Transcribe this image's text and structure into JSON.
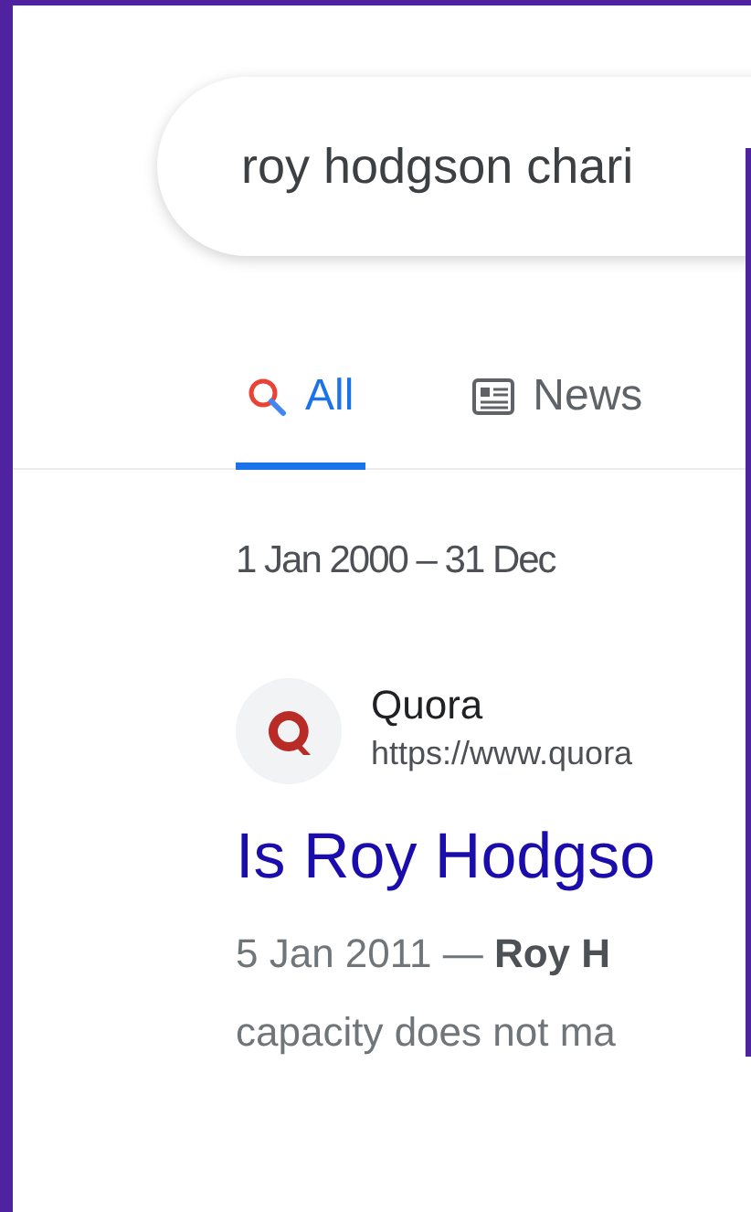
{
  "search": {
    "value": "roy hodgson chari"
  },
  "tabs": [
    {
      "label": "All",
      "kind": "search",
      "selected": true
    },
    {
      "label": "News",
      "kind": "news",
      "selected": false
    }
  ],
  "date_range": "1 Jan 2000 – 31 Dec",
  "result": {
    "site": "Quora",
    "url": "https://www.quora",
    "title": "Is Roy Hodgso",
    "snippet_lines": [
      "5 Jan 2011 — **Roy H**",
      "capacity does not ma"
    ]
  }
}
